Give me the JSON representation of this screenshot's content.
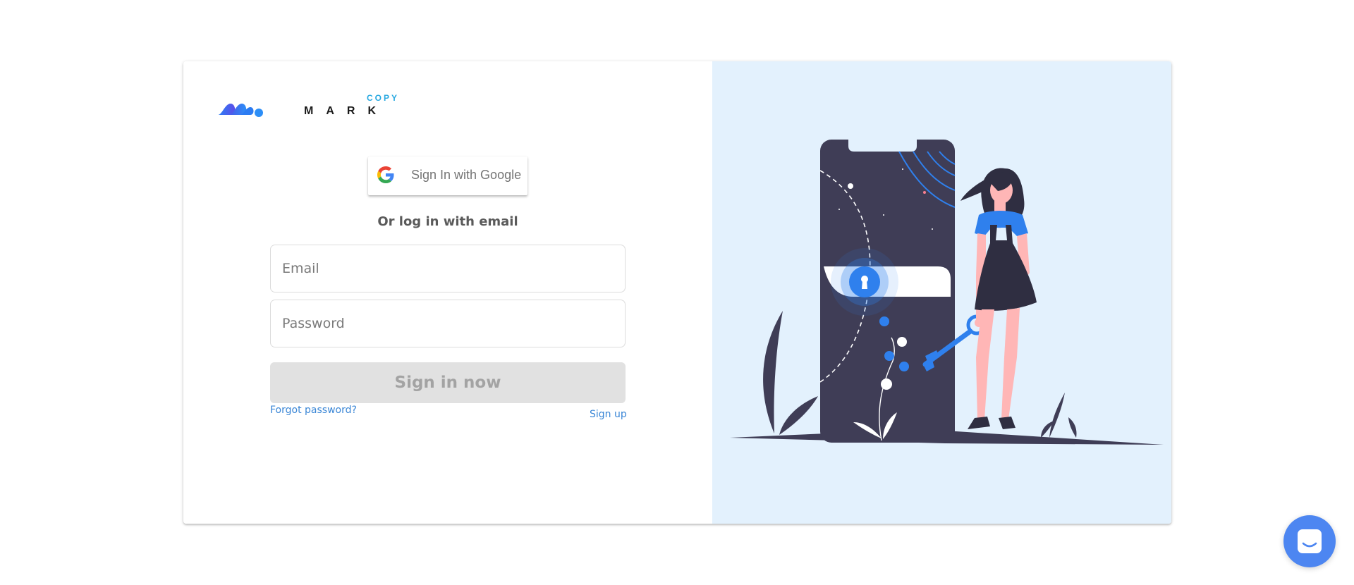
{
  "brand": {
    "logo_main": "MARK",
    "logo_sub": "COPY"
  },
  "auth": {
    "google_button_label": "Sign In with Google",
    "divider_text": "Or log in with email",
    "email_placeholder": "Email",
    "password_placeholder": "Password",
    "submit_label": "Sign in now",
    "forgot_password_label": "Forgot password?",
    "signup_label": "Sign up"
  },
  "colors": {
    "accent": "#4d86f1",
    "link": "#3a86d6",
    "illustration_background": "#e3f1fd",
    "button_disabled": "#e1e1e1"
  },
  "icons": {
    "google": "google-g-icon",
    "illustration": "phone-lock-woman-with-key",
    "chat": "chat-bubble-icon"
  }
}
